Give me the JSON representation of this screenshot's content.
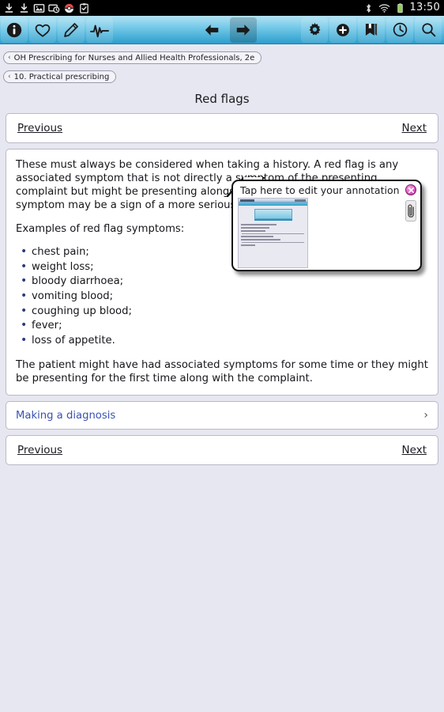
{
  "statusbar": {
    "left_icons": [
      "download-icon",
      "download-icon",
      "image-icon",
      "screenshot-clock-icon",
      "pokeball-icon",
      "clipboard-check-icon"
    ],
    "right_icons": [
      "bluetooth-icon",
      "wifi-icon",
      "battery-icon"
    ],
    "clock": "13:50"
  },
  "toolbar": {
    "left_buttons": [
      {
        "name": "info-icon",
        "label": "Info"
      },
      {
        "name": "heart-icon",
        "label": "Favourites"
      },
      {
        "name": "pencil-icon",
        "label": "Annotate"
      },
      {
        "name": "pulse-icon",
        "label": "Vitals"
      }
    ],
    "center_buttons": [
      {
        "name": "arrow-back-icon",
        "label": "Back",
        "active": false
      },
      {
        "name": "arrow-forward-icon",
        "label": "Forward",
        "active": true
      }
    ],
    "right_buttons": [
      {
        "name": "gear-icon",
        "label": "Settings"
      },
      {
        "name": "plus-circle-icon",
        "label": "Add"
      },
      {
        "name": "bookmark-icon",
        "label": "Bookmarks"
      },
      {
        "name": "clock-icon",
        "label": "History"
      },
      {
        "name": "search-icon",
        "label": "Search"
      }
    ]
  },
  "breadcrumbs": [
    {
      "chevron": "‹",
      "label": "OH Prescribing for Nurses and Allied Health Professionals, 2e"
    },
    {
      "chevron": "‹",
      "label": "10. Practical prescribing"
    }
  ],
  "page": {
    "title": "Red flags"
  },
  "nav_top": {
    "previous": "Previous",
    "next": "Next"
  },
  "nav_bottom": {
    "previous": "Previous",
    "next": "Next"
  },
  "body": {
    "para1_before": "These must always be considered when taking a history. A red flag is any associated symptom that is not directly a symptom of the presenting complaint but might be presenting alongside the main ",
    "para1_marker": "⁄",
    "para1_highlight": "complaint",
    "para1_after": ". A red flag symptom may be a sign of a more serious or underlying condition.",
    "para2": "Examples of red flag symptoms:",
    "symptoms": [
      "chest pain;",
      "weight loss;",
      "bloody diarrhoea;",
      "vomiting blood;",
      "coughing up blood;",
      "fever;",
      "loss of appetite."
    ],
    "para3": "The patient might have had associated symptoms for some time or they might be presenting for the first time along with the complaint."
  },
  "next_section": {
    "label": "Making a diagnosis",
    "chevron": "›"
  },
  "annotation": {
    "title": "Tap here to edit your annotation",
    "close_icon": "close-icon",
    "attachment_icon": "paperclip-icon",
    "thumbnail_name": "annotation-thumbnail"
  },
  "colors": {
    "toolbar_top": "#b3e2f2",
    "toolbar_bottom": "#2c9ecd",
    "page_background": "#e7e7f1",
    "card_background": "#ffffff",
    "link_blue": "#3a52b4",
    "highlight_yellow": "#ffff00",
    "bullet_navy": "#2b3a7a",
    "close_pink": "#e057c0",
    "status_bar_black": "#000000"
  }
}
